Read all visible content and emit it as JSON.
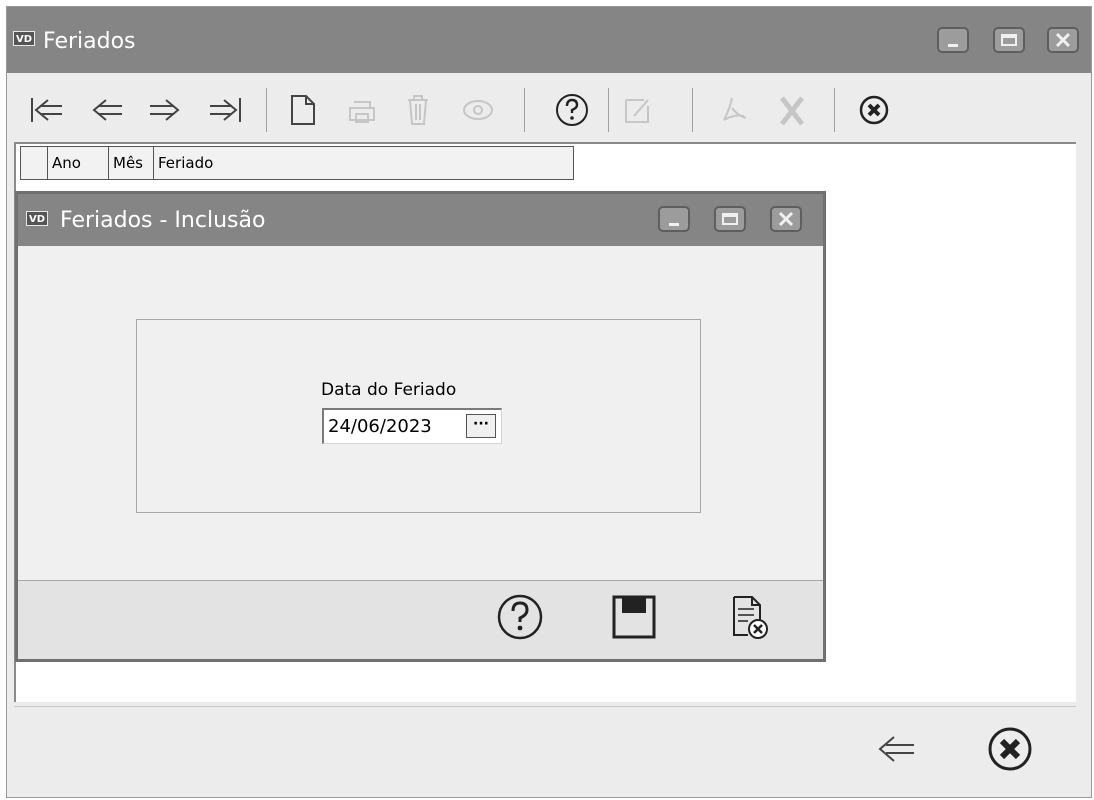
{
  "main_window": {
    "logo_text": "VD",
    "title": "Feriados"
  },
  "toolbar": {
    "icons": [
      "first-record-icon",
      "previous-record-icon",
      "next-record-icon",
      "last-record-icon",
      "new-document-icon",
      "print-icon",
      "delete-icon",
      "view-icon",
      "help-icon",
      "edit-icon",
      "pdf-icon",
      "excel-icon",
      "close-icon"
    ]
  },
  "grid": {
    "columns": [
      "Ano",
      "Mês",
      "Feriado"
    ]
  },
  "dialog": {
    "logo_text": "VD",
    "title": "Feriados - Inclusão",
    "field_label": "Data do Feriado",
    "date_value": "24/06/2023",
    "picker_label": "···"
  },
  "colors": {
    "titlebar": "#858585",
    "window_bg": "#ececec"
  }
}
